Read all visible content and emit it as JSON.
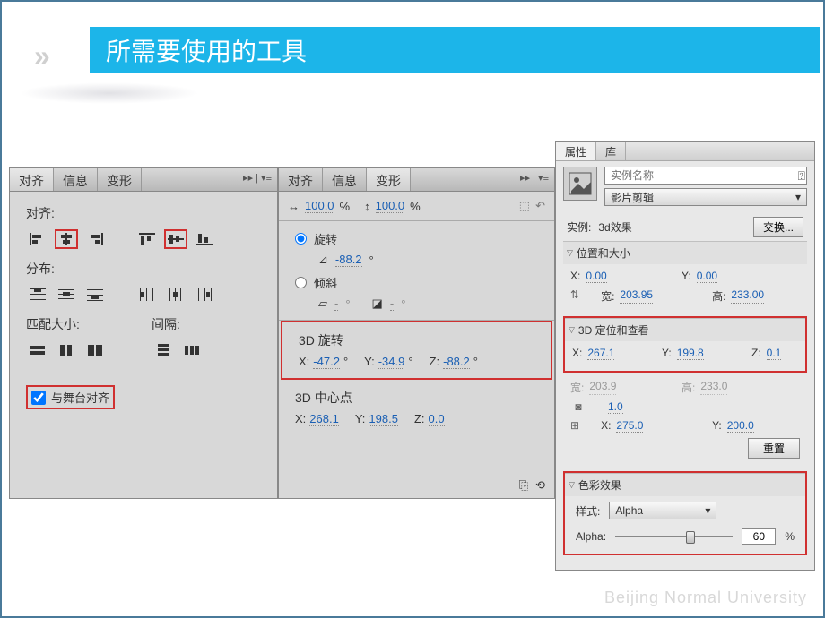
{
  "header": {
    "title": "所需要使用的工具"
  },
  "panel1": {
    "tabs": [
      "对齐",
      "信息",
      "变形"
    ],
    "sect_align": "对齐:",
    "sect_distribute": "分布:",
    "sect_match": "匹配大小:",
    "sect_gap": "间隔:",
    "stage_align": "与舞台对齐"
  },
  "panel2": {
    "tabs": [
      "对齐",
      "信息",
      "变形"
    ],
    "scale_w": "100.0",
    "scale_w_pct": "%",
    "scale_h": "100.0",
    "scale_h_pct": "%",
    "rotate_label": "旋转",
    "rotate_val": "-88.2",
    "skew_label": "倾斜",
    "skew_v1": "-",
    "skew_v2": "-",
    "rot3d_label": "3D 旋转",
    "rot3d": {
      "x": "-47.2",
      "y": "-34.9",
      "z": "-88.2"
    },
    "center3d_label": "3D 中心点",
    "center3d": {
      "x": "268.1",
      "y": "198.5",
      "z": "0.0"
    }
  },
  "panel3": {
    "tabs": [
      "属性",
      "库"
    ],
    "instance_placeholder": "实例名称",
    "type": "影片剪辑",
    "instance_label": "实例:",
    "instance_name": "3d效果",
    "swap_btn": "交换...",
    "sect_pos_size": "位置和大小",
    "pos": {
      "x": "0.00",
      "y": "0.00"
    },
    "size": {
      "w_label": "宽:",
      "w": "203.95",
      "h_label": "高:",
      "h": "233.00"
    },
    "sect_3d": "3D 定位和查看",
    "pos3d": {
      "x": "267.1",
      "y": "199.8",
      "z": "0.1"
    },
    "size3d": {
      "w_label": "宽:",
      "w": "203.9",
      "h_label": "高:",
      "h": "233.0"
    },
    "persp": "1.0",
    "vanish": {
      "x": "275.0",
      "y": "200.0"
    },
    "reset_btn": "重置",
    "sect_color": "色彩效果",
    "style_label": "样式:",
    "style_val": "Alpha",
    "alpha_label": "Alpha:",
    "alpha_val": "60",
    "alpha_pct": "%"
  },
  "watermark": "Beijing Normal University"
}
